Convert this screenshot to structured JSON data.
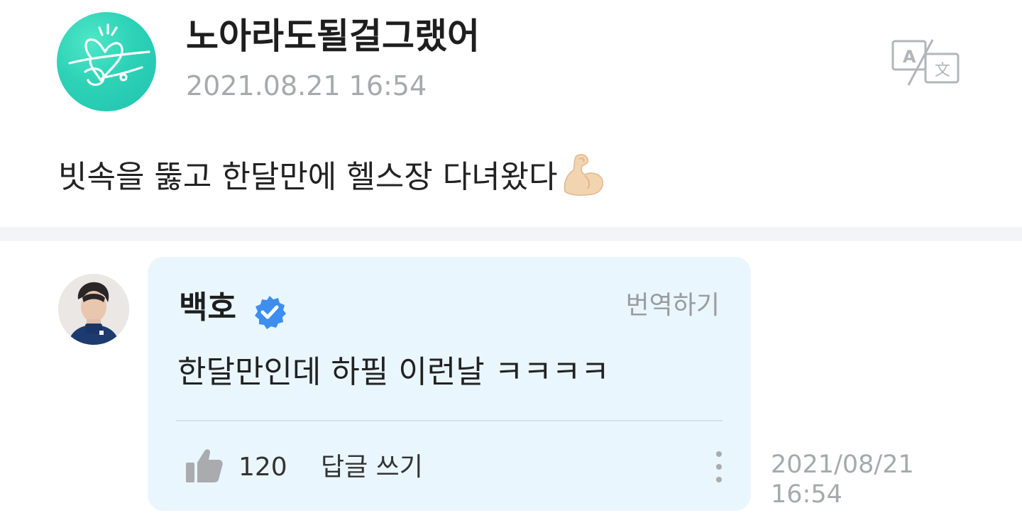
{
  "post": {
    "author": "노아라도될걸그랬어",
    "date": "2021.08.21 16:54",
    "body": "빗속을 뚫고 한달만에 헬스장 다녀왔다",
    "emoji": "flexed-biceps-emoji",
    "translate_icon": "translate-icon",
    "avatar_icon": "heart-signature-logo"
  },
  "comment": {
    "author": "백호",
    "verified_icon": "verified-badge-icon",
    "translate_label": "번역하기",
    "text": "한달만인데 하필 이런날 ㅋㅋㅋㅋ",
    "like_icon": "thumbs-up-icon",
    "like_count": "120",
    "reply_label": "답글 쓰기",
    "more_icon": "more-vertical-icon",
    "date_line1": "2021/08/21",
    "date_line2": "16:54"
  },
  "colors": {
    "avatar_teal": "#2dd2b6",
    "comment_bg": "#eaf6fd",
    "verified_blue": "#3d8ef0",
    "meta_gray": "#a7a9ad"
  }
}
